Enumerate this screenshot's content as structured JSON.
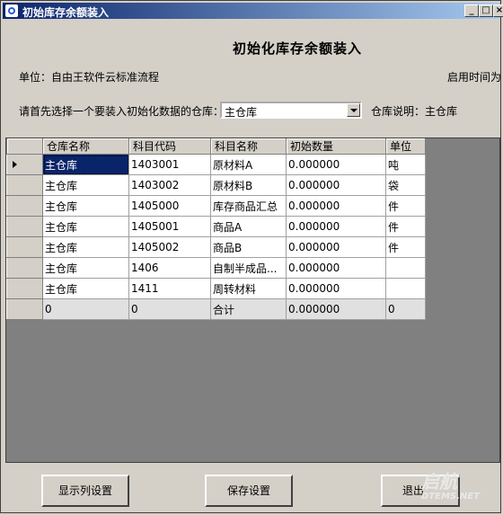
{
  "window": {
    "title": "初始库存余额装入",
    "minimize": "_",
    "maximize": "□",
    "close": "×"
  },
  "heading": "初始化库存余额装入",
  "unit_label": "单位：自由王软件云标准流程",
  "enable_time_label": "启用时间为",
  "warehouse_prompt": "请首先选择一个要装入初始化数据的仓库：",
  "warehouse_select": {
    "value": "主仓库"
  },
  "warehouse_desc": "仓库说明：主仓库",
  "grid": {
    "columns": [
      "仓库名称",
      "科目代码",
      "科目名称",
      "初始数量",
      "单位"
    ],
    "rows": [
      [
        "主仓库",
        "1403001",
        "原材料A",
        "0.000000",
        "吨"
      ],
      [
        "主仓库",
        "1403002",
        "原材料B",
        "0.000000",
        "袋"
      ],
      [
        "主仓库",
        "1405000",
        "库存商品汇总",
        "0.000000",
        "件"
      ],
      [
        "主仓库",
        "1405001",
        "商品A",
        "0.000000",
        "件"
      ],
      [
        "主仓库",
        "1405002",
        "商品B",
        "0.000000",
        "件"
      ],
      [
        "主仓库",
        "1406",
        "自制半成品...",
        "0.000000",
        ""
      ],
      [
        "主仓库",
        "1411",
        "周转材料",
        "0.000000",
        ""
      ]
    ],
    "total_row": [
      "0",
      "0",
      "合计",
      "0.000000",
      "0"
    ]
  },
  "buttons": {
    "show_columns": "显示列设置",
    "save": "保存设置",
    "exit": "退出"
  },
  "watermark": {
    "main": "启航",
    "sub": "DTEMS.NET"
  }
}
